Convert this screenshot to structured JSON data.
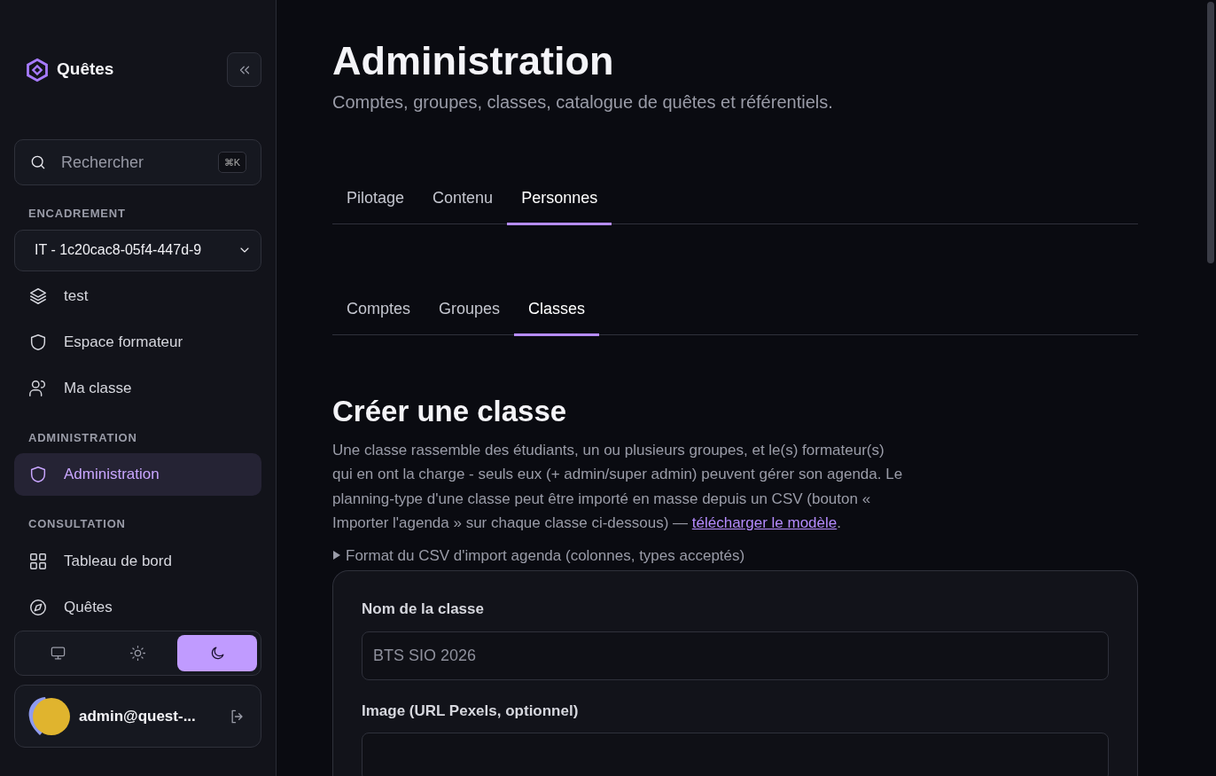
{
  "sidebar": {
    "brand": "Quêtes",
    "search": {
      "placeholder": "Rechercher",
      "shortcut": "⌘K"
    },
    "sections": [
      {
        "label": "ENCADREMENT",
        "select": {
          "value": "IT - 1c20cac8-05f4-447d-9"
        },
        "items": [
          {
            "label": "test",
            "selected": false
          },
          {
            "label": "Espace formateur",
            "selected": false
          },
          {
            "label": "Ma classe",
            "selected": false
          }
        ]
      },
      {
        "label": "ADMINISTRATION",
        "items": [
          {
            "label": "Administration",
            "selected": true
          }
        ]
      },
      {
        "label": "CONSULTATION",
        "items": [
          {
            "label": "Tableau de bord",
            "selected": false
          },
          {
            "label": "Quêtes",
            "selected": false
          }
        ]
      }
    ],
    "theme_options": [
      {
        "selected": false
      },
      {
        "selected": false
      },
      {
        "selected": true
      }
    ],
    "user": {
      "email": "admin@quest-..."
    }
  },
  "page": {
    "title": "Administration",
    "subtitle": "Comptes, groupes, classes, catalogue de quêtes et référentiels.",
    "tabs": [
      {
        "label": "Pilotage",
        "selected": false
      },
      {
        "label": "Contenu",
        "selected": false
      },
      {
        "label": "Personnes",
        "selected": true
      }
    ],
    "subtabs": [
      {
        "label": "Comptes",
        "selected": false
      },
      {
        "label": "Groupes",
        "selected": false
      },
      {
        "label": "Classes",
        "selected": true
      }
    ],
    "section_title": "Créer une classe",
    "description": "Une classe rassemble des étudiants, un ou plusieurs groupes, et le(s) formateur(s) qui en ont la charge - seuls eux (+ admin/super admin) peuvent gérer son agenda. Le planning-type d'une classe peut être importé en masse depuis un CSV (bouton « Importer l'agenda » sur chaque classe ci-dessous) — ",
    "description_link": "télécharger le modèle",
    "description_end": ".",
    "details_summary": "Format du CSV d'import agenda (colonnes, types acceptés)",
    "form": {
      "fields": [
        {
          "label": "Nom de la classe",
          "placeholder": "BTS SIO 2026"
        },
        {
          "label": "Image (URL Pexels, optionnel)"
        }
      ]
    }
  }
}
